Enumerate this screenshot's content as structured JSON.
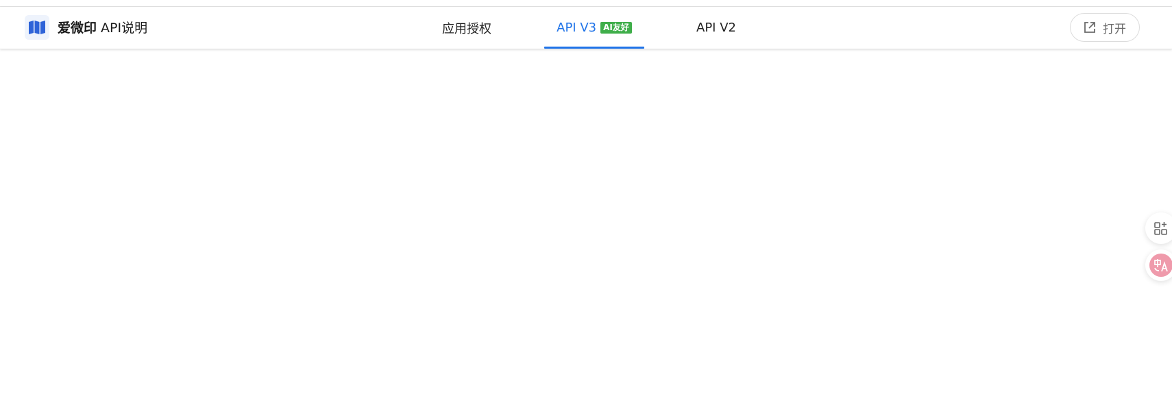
{
  "header": {
    "brand_name": "爱微印",
    "brand_suffix": " API说明",
    "logo_icon": "book-open-icon"
  },
  "nav": {
    "tabs": [
      {
        "label": "应用授权",
        "active": false
      },
      {
        "label": "API V3",
        "active": true,
        "badge": "AI友好"
      },
      {
        "label": "API V2",
        "active": false
      }
    ]
  },
  "actions": {
    "open_label": "打开",
    "open_icon": "external-link-icon"
  },
  "floating": {
    "apps_icon": "apps-add-icon",
    "translate_icon": "translate-icon"
  },
  "colors": {
    "accent": "#1f73e8",
    "badge": "#3fae4a",
    "translate": "#ef9aab"
  }
}
